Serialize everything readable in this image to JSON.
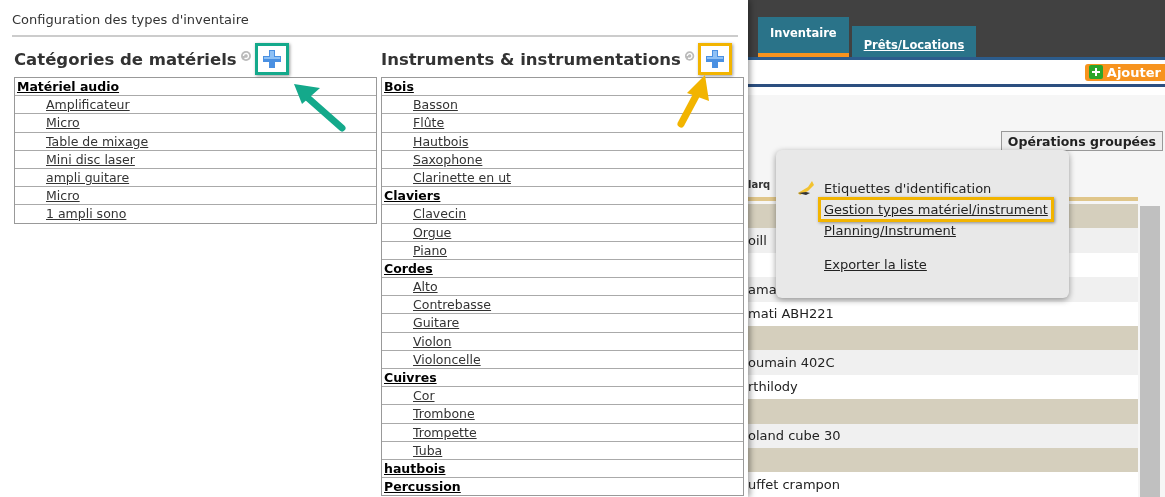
{
  "dialog": {
    "title": "Configuration des types d'inventaire",
    "panels": [
      {
        "heading": "Catégories de matériels",
        "groups": [
          {
            "name": "Matériel audio",
            "items": [
              "Amplificateur",
              "Micro",
              "Table de mixage",
              "Mini disc laser",
              "ampli guitare",
              "Micro",
              "1 ampli sono"
            ]
          }
        ]
      },
      {
        "heading": "Instruments & instrumentations",
        "groups": [
          {
            "name": "Bois",
            "items": [
              "Basson",
              "Flûte",
              "Hautbois",
              "Saxophone",
              "Clarinette en ut"
            ]
          },
          {
            "name": "Claviers",
            "items": [
              "Clavecin",
              "Orgue",
              "Piano"
            ]
          },
          {
            "name": "Cordes",
            "items": [
              "Alto",
              "Contrebasse",
              "Guitare",
              "Violon",
              "Violoncelle"
            ]
          },
          {
            "name": "Cuivres",
            "items": [
              "Cor",
              "Trombone",
              "Trompette",
              "Tuba"
            ]
          },
          {
            "name": "hautbois"
          },
          {
            "name": "Percussion"
          }
        ]
      }
    ]
  },
  "page": {
    "tabs": [
      {
        "label": "Inventaire",
        "selected": true
      },
      {
        "label": "Prêts/Locations",
        "selected": false
      }
    ],
    "add_button": "Ajouter",
    "bulk_button": "Opérations groupées",
    "column_1": "larq",
    "rows": [
      {
        "kind": "group"
      },
      {
        "kind": "item",
        "text": "oill",
        "striped": true
      },
      {
        "kind": "item",
        "striped": false
      },
      {
        "kind": "item",
        "text": "ama",
        "striped": true
      },
      {
        "kind": "item",
        "text": "mati ABH221",
        "striped": false
      },
      {
        "kind": "group"
      },
      {
        "kind": "item",
        "text": "oumain 402C",
        "striped": true
      },
      {
        "kind": "item",
        "text": "rthilody",
        "striped": false
      },
      {
        "kind": "group"
      },
      {
        "kind": "item",
        "text": "oland cube 30",
        "striped": true
      },
      {
        "kind": "group"
      },
      {
        "kind": "item",
        "text": "uffet crampon",
        "striped": false
      }
    ],
    "menu": [
      {
        "label": "Etiquettes d'identification",
        "link": false,
        "has_icon": true,
        "highlighted": false
      },
      {
        "label": "Gestion types matériel/instrument",
        "link": true,
        "has_icon": false,
        "highlighted": true
      },
      {
        "label": "Planning/Instrument",
        "link": true,
        "has_icon": false,
        "highlighted": false
      },
      {
        "label": "Exporter la liste",
        "link": true,
        "has_icon": false,
        "highlighted": false
      }
    ]
  }
}
